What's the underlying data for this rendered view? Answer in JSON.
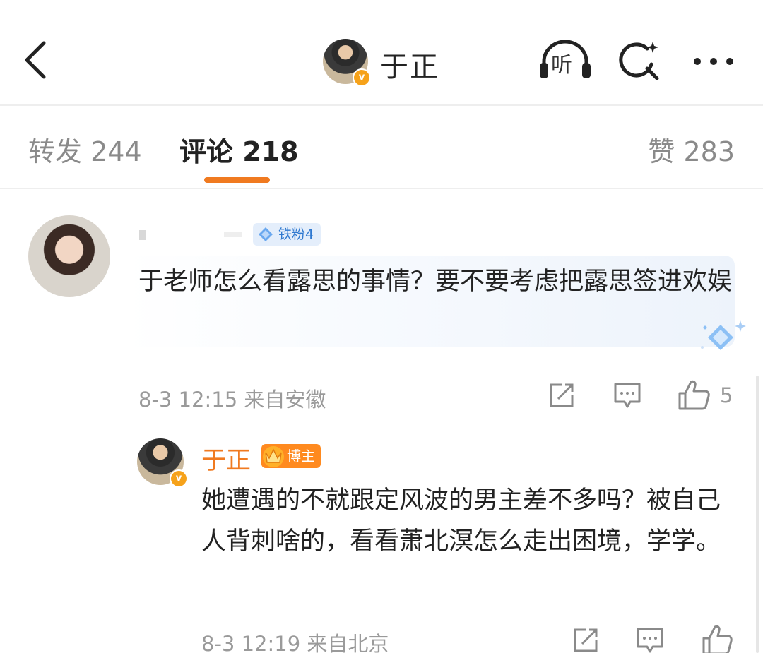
{
  "header": {
    "username": "于正",
    "verified_badge": "v",
    "listen_label": "听"
  },
  "tabs": [
    {
      "label": "转发",
      "count": "244"
    },
    {
      "label": "评论",
      "count": "218"
    },
    {
      "label": "赞",
      "count": "283"
    }
  ],
  "comment": {
    "fan_badge": "铁粉4",
    "text": "于老师怎么看露思的事情？要不要考虑把露思签进欢娱",
    "time": "8-3 12:15",
    "location": "来自安徽",
    "likes": "5"
  },
  "reply": {
    "username": "于正",
    "verified_badge": "v",
    "role_badge": "博主",
    "text": "她遭遇的不就跟定风波的男主差不多吗？被自己人背刺啥的，看看萧北溟怎么走出困境，学学。",
    "time": "8-3 12:19",
    "location": "来自北京"
  },
  "colors": {
    "accent": "#f07a20",
    "fan_badge_bg": "#e4eefb",
    "fan_badge_text": "#2f79d0",
    "verified": "#f6a21a",
    "meta_text": "#9a9a9a"
  },
  "icons": {
    "back": "chevron-left-icon",
    "listen": "headphones-icon",
    "search": "search-sparkle-icon",
    "more": "more-dots-icon",
    "share": "share-icon",
    "reply": "comment-icon",
    "like": "thumbs-up-icon"
  }
}
